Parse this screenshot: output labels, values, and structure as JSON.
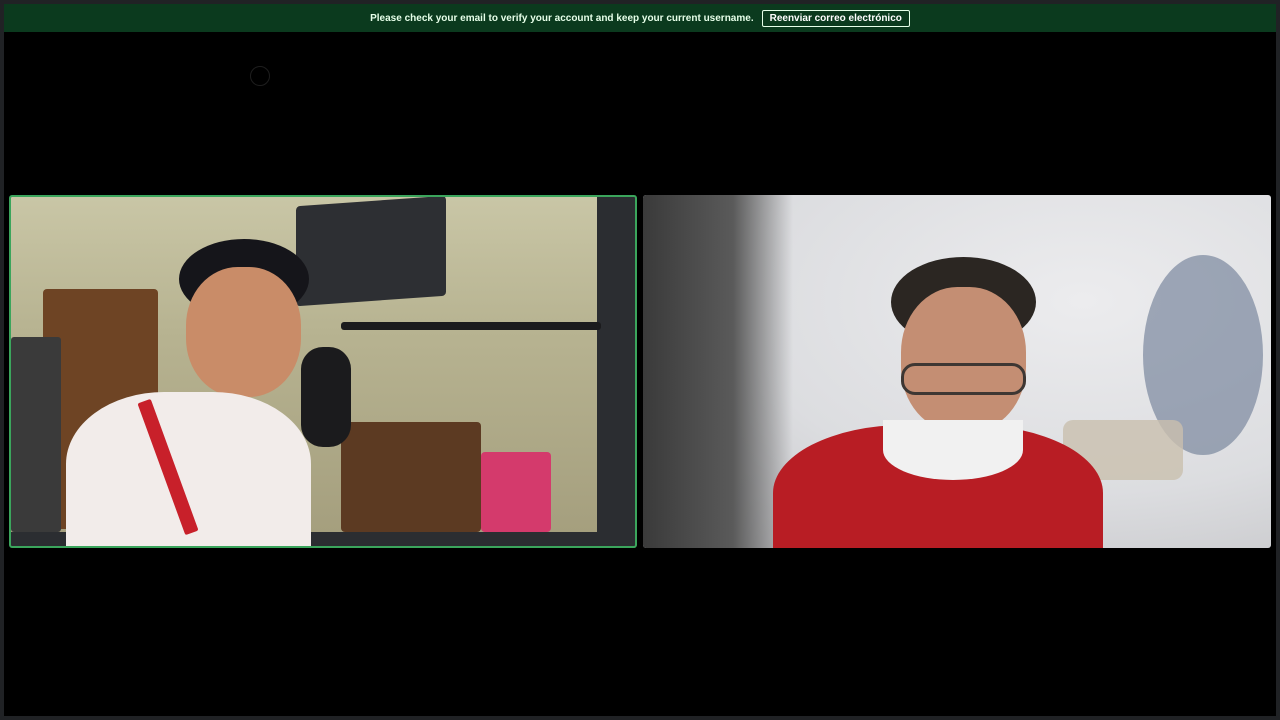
{
  "banner": {
    "message": "Please check your email to verify your account and keep your current username.",
    "button_label": "Reenviar correo electrónico"
  },
  "colors": {
    "banner_bg": "#0b3a1e",
    "speaking_outline": "#3ba55c",
    "background": "#000000"
  },
  "tiles": [
    {
      "id": "participant-1",
      "speaking": true
    },
    {
      "id": "participant-2",
      "speaking": false
    }
  ]
}
